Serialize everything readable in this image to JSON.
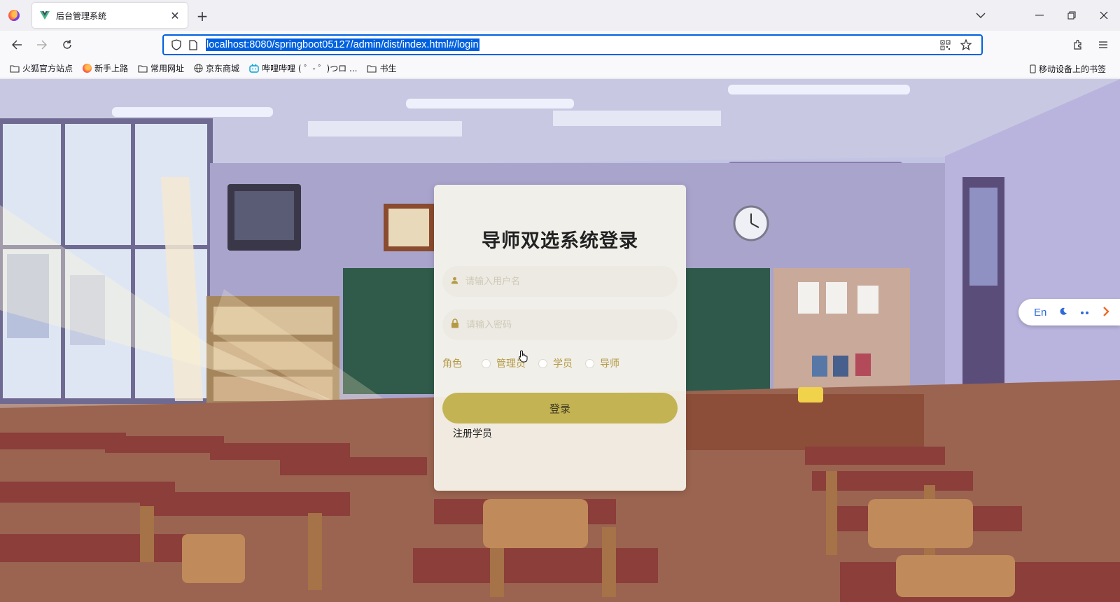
{
  "browser": {
    "tab": {
      "title": "后台管理系统"
    },
    "url": "localhost:8080/springboot05127/admin/dist/index.html#/login",
    "bookmarks": [
      {
        "label": "火狐官方站点",
        "icon": "folder-icon"
      },
      {
        "label": "新手上路",
        "icon": "firefox-icon"
      },
      {
        "label": "常用网址",
        "icon": "folder-icon"
      },
      {
        "label": "京东商城",
        "icon": "globe-icon"
      },
      {
        "label": "哔哩哔哩 ( ゜- ゜)つロ ...",
        "icon": "bilibili-icon"
      },
      {
        "label": "书生",
        "icon": "folder-icon"
      }
    ],
    "mobile_bookmarks": "移动设备上的书签",
    "colors": {
      "accent": "#0061e0"
    }
  },
  "login": {
    "title": "导师双选系统登录",
    "username_placeholder": "请输入用户名",
    "password_placeholder": "请输入密码",
    "role_label": "角色",
    "roles": [
      "管理员",
      "学员",
      "导师"
    ],
    "login_button": "登录",
    "register_link": "注册学员",
    "colors": {
      "button": "#c3b352",
      "label": "#b49a44"
    }
  },
  "widget": {
    "lang": "En",
    "moon_icon": "moon-icon",
    "dots_icon": "dots-icon",
    "arrow_icon": "arrow-right-icon"
  }
}
